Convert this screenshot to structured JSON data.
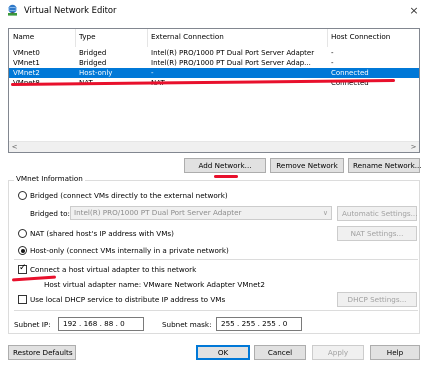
{
  "window": {
    "title": "Virtual Network Editor",
    "close_glyph": "×"
  },
  "table": {
    "headers": {
      "name": "Name",
      "type": "Type",
      "external": "External Connection",
      "host": "Host Connection"
    },
    "rows": [
      {
        "name": "VMnet0",
        "type": "Bridged",
        "external": "Intel(R) PRO/1000 PT Dual Port Server Adapter",
        "host": "-"
      },
      {
        "name": "VMnet1",
        "type": "Bridged",
        "external": "Intel(R) PRO/1000 PT Dual Port Server Adap...",
        "host": "-"
      },
      {
        "name": "VMnet2",
        "type": "Host-only",
        "external": "-",
        "host": "Connected"
      },
      {
        "name": "VMnet8",
        "type": "NAT",
        "external": "NAT",
        "host": "Connected"
      }
    ],
    "selected_row": 2,
    "selection_color": "#0078d7"
  },
  "table_buttons": {
    "add": "Add Network...",
    "remove": "Remove Network",
    "rename": "Rename Network..."
  },
  "vmnet_info": {
    "group_label": "VMnet Information",
    "bridged_label": "Bridged (connect VMs directly to the external network)",
    "bridged_to_label": "Bridged to:",
    "bridged_to_value": "Intel(R) PRO/1000 PT Dual Port Server Adapter",
    "automatic_settings": "Automatic Settings...",
    "nat_label": "NAT (shared host's IP address with VMs)",
    "nat_settings": "NAT Settings...",
    "hostonly_label": "Host-only (connect VMs internally in a private network)",
    "selected_mode": "host-only",
    "connect_adapter_label": "Connect a host virtual adapter to this network",
    "connect_adapter_checked": true,
    "adapter_name_text": "Host virtual adapter name: VMware Network Adapter VMnet2",
    "dhcp_label": "Use local DHCP service to distribute IP address to VMs",
    "dhcp_checked": false,
    "dhcp_settings": "DHCP Settings...",
    "subnet_ip_label": "Subnet IP:",
    "subnet_ip_value": "192 . 168 . 88 . 0",
    "subnet_mask_label": "Subnet mask:",
    "subnet_mask_value": "255 . 255 . 255 . 0"
  },
  "footer": {
    "restore": "Restore Defaults",
    "ok": "OK",
    "cancel": "Cancel",
    "apply": "Apply",
    "help": "Help"
  },
  "icons": {
    "app": "network-editor-icon",
    "scroll_left": "scroll-left-arrow",
    "scroll_right": "scroll-right-arrow",
    "combo": "chevron-down-icon",
    "radio": "radio-dot-icon",
    "check": "checkmark-icon"
  },
  "colors": {
    "annotation_red": "#e8102c"
  },
  "glyphs": {
    "scroll_left": "<",
    "scroll_right": ">",
    "combo_caret": "∨",
    "checkmark": "✓"
  }
}
